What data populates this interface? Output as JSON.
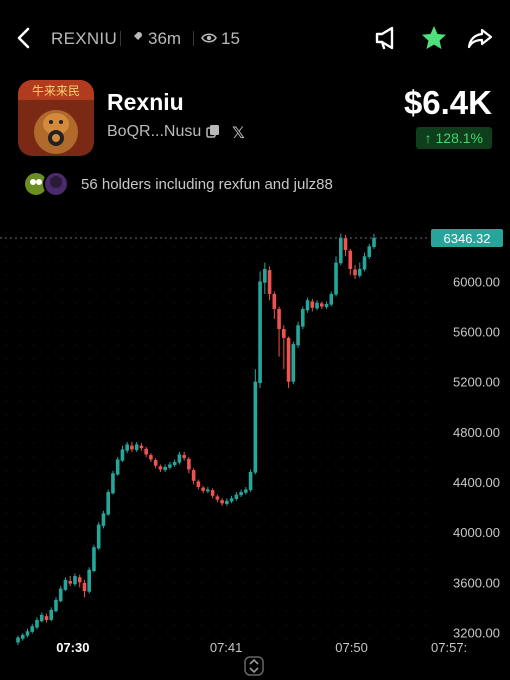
{
  "header": {
    "ticker": "REXNIU",
    "age": "36m",
    "views": "15"
  },
  "token": {
    "name": "Rexniu",
    "address": "BoQR...Nusu",
    "price": "$6.4K",
    "change": "↑ 128.1%",
    "holders_text": "56 holders including rexfun and julz88",
    "banner_text": "牛来来民"
  },
  "colors": {
    "up": "#26a69a",
    "down": "#ef5350",
    "accent_green": "#3fd86a",
    "price_tag": "#26a69a"
  },
  "icons": [
    "back-icon",
    "rocket-icon",
    "eye-icon",
    "megaphone-icon",
    "star-icon",
    "share-icon",
    "copy-icon",
    "x-logo-icon",
    "scroll-icon"
  ],
  "chart_data": {
    "type": "candlestick",
    "current_value": 6346.32,
    "current_label": "6346.32",
    "y_ticks": [
      "6000.00",
      "5600.00",
      "5200.00",
      "4800.00",
      "4400.00",
      "4000.00",
      "3600.00",
      "3200.00"
    ],
    "y_tick_values": [
      6000,
      5600,
      5200,
      4800,
      4400,
      4000,
      3600,
      3200
    ],
    "ylim": [
      3100,
      6450
    ],
    "x_ticks": [
      "07:30",
      "07:41",
      "07:50",
      "07:57:"
    ],
    "x_tick_minutes": [
      30,
      41,
      50,
      57
    ],
    "xlim": [
      27.5,
      58.5
    ],
    "candles": [
      [
        3120,
        3160,
        3100,
        3175
      ],
      [
        3150,
        3180,
        3135,
        3195
      ],
      [
        3175,
        3210,
        3160,
        3230
      ],
      [
        3205,
        3250,
        3190,
        3270
      ],
      [
        3240,
        3300,
        3225,
        3320
      ],
      [
        3290,
        3340,
        3280,
        3360
      ],
      [
        3330,
        3300,
        3280,
        3350
      ],
      [
        3300,
        3380,
        3290,
        3400
      ],
      [
        3370,
        3460,
        3360,
        3480
      ],
      [
        3450,
        3550,
        3440,
        3570
      ],
      [
        3540,
        3620,
        3530,
        3640
      ],
      [
        3610,
        3590,
        3570,
        3650
      ],
      [
        3585,
        3650,
        3570,
        3670
      ],
      [
        3640,
        3600,
        3560,
        3660
      ],
      [
        3595,
        3530,
        3480,
        3620
      ],
      [
        3525,
        3700,
        3510,
        3720
      ],
      [
        3690,
        3880,
        3680,
        3900
      ],
      [
        3870,
        4060,
        3860,
        4080
      ],
      [
        4050,
        4150,
        4030,
        4170
      ],
      [
        4140,
        4320,
        4130,
        4340
      ],
      [
        4310,
        4470,
        4300,
        4490
      ],
      [
        4460,
        4580,
        4450,
        4600
      ],
      [
        4570,
        4660,
        4560,
        4690
      ],
      [
        4650,
        4700,
        4630,
        4720
      ],
      [
        4690,
        4660,
        4640,
        4720
      ],
      [
        4655,
        4700,
        4640,
        4720
      ],
      [
        4690,
        4670,
        4650,
        4710
      ],
      [
        4665,
        4620,
        4600,
        4680
      ],
      [
        4615,
        4580,
        4560,
        4630
      ],
      [
        4575,
        4530,
        4510,
        4590
      ],
      [
        4525,
        4500,
        4480,
        4540
      ],
      [
        4495,
        4520,
        4480,
        4540
      ],
      [
        4515,
        4540,
        4500,
        4560
      ],
      [
        4535,
        4560,
        4520,
        4580
      ],
      [
        4555,
        4620,
        4540,
        4640
      ],
      [
        4615,
        4590,
        4570,
        4640
      ],
      [
        4585,
        4500,
        4470,
        4600
      ],
      [
        4495,
        4410,
        4380,
        4510
      ],
      [
        4405,
        4360,
        4340,
        4420
      ],
      [
        4355,
        4330,
        4310,
        4370
      ],
      [
        4325,
        4340,
        4310,
        4360
      ],
      [
        4335,
        4290,
        4270,
        4350
      ],
      [
        4285,
        4260,
        4240,
        4300
      ],
      [
        4255,
        4230,
        4210,
        4270
      ],
      [
        4225,
        4250,
        4210,
        4270
      ],
      [
        4245,
        4270,
        4230,
        4290
      ],
      [
        4265,
        4300,
        4250,
        4320
      ],
      [
        4295,
        4320,
        4280,
        4340
      ],
      [
        4315,
        4340,
        4300,
        4360
      ],
      [
        4335,
        4480,
        4320,
        4500
      ],
      [
        4475,
        5200,
        4460,
        5300
      ],
      [
        5190,
        6000,
        5150,
        6080
      ],
      [
        5990,
        6100,
        5900,
        6150
      ],
      [
        6090,
        5900,
        5850,
        6120
      ],
      [
        5900,
        5780,
        5700,
        5920
      ],
      [
        5780,
        5620,
        5400,
        5800
      ],
      [
        5620,
        5550,
        5300,
        5650
      ],
      [
        5550,
        5200,
        5150,
        5560
      ],
      [
        5200,
        5500,
        5180,
        5520
      ],
      [
        5490,
        5650,
        5470,
        5680
      ],
      [
        5640,
        5780,
        5620,
        5800
      ],
      [
        5770,
        5850,
        5750,
        5870
      ],
      [
        5840,
        5790,
        5760,
        5860
      ],
      [
        5785,
        5830,
        5770,
        5850
      ],
      [
        5825,
        5800,
        5780,
        5840
      ],
      [
        5795,
        5820,
        5780,
        5840
      ],
      [
        5815,
        5900,
        5800,
        5920
      ],
      [
        5895,
        6150,
        5880,
        6200
      ],
      [
        6145,
        6350,
        6130,
        6380
      ],
      [
        6345,
        6250,
        6200,
        6370
      ],
      [
        6245,
        6100,
        6050,
        6260
      ],
      [
        6095,
        6050,
        6020,
        6130
      ],
      [
        6045,
        6100,
        6030,
        6150
      ],
      [
        6095,
        6200,
        6080,
        6230
      ],
      [
        6195,
        6280,
        6180,
        6300
      ],
      [
        6275,
        6346,
        6260,
        6380
      ]
    ]
  }
}
